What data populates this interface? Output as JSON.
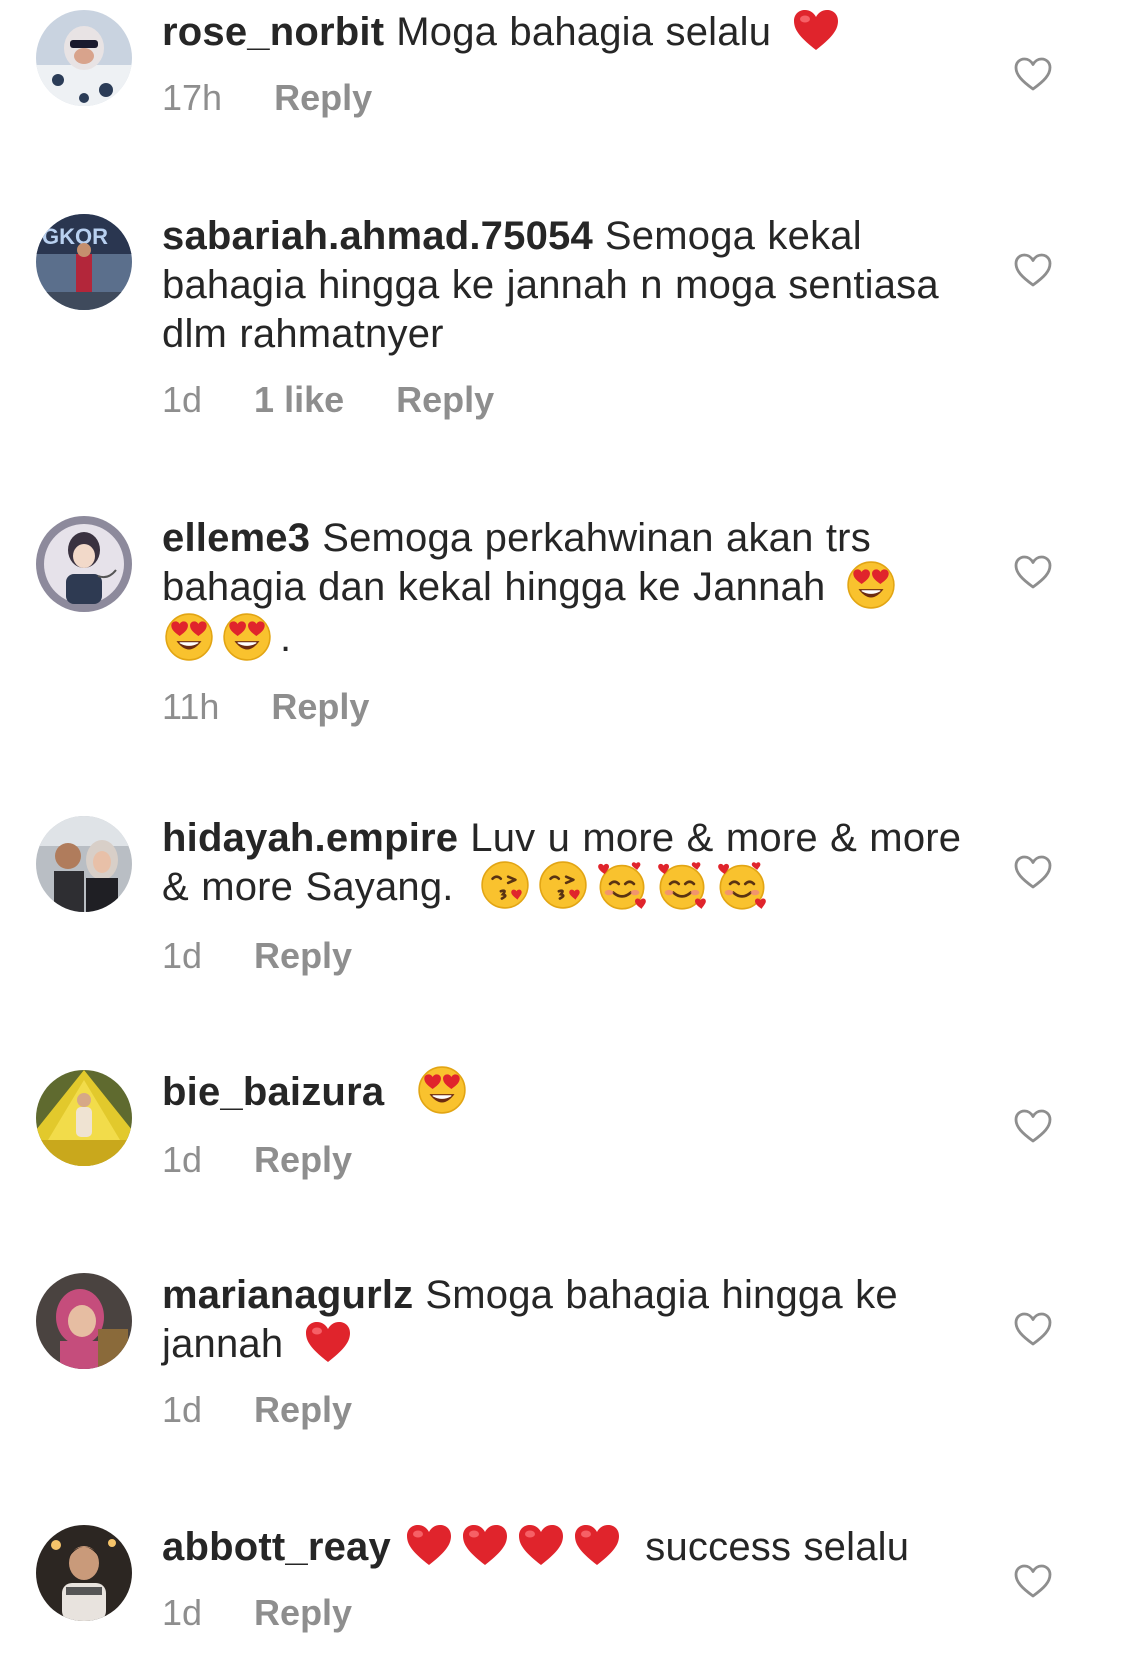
{
  "comments": [
    {
      "username": "rose_norbit",
      "text": "Moga bahagia selalu",
      "time": "17h",
      "likes": "",
      "reply": "Reply"
    },
    {
      "username": "sabariah.ahmad.75054",
      "text": "Semoga kekal bahagia hingga ke jannah n moga sentiasa dlm rahmatnyer",
      "time": "1d",
      "likes": "1 like",
      "reply": "Reply"
    },
    {
      "username": "elleme3",
      "text": "Semoga perkahwinan akan trs bahagia dan kekal hingga ke Jannah",
      "text_suffix": ".",
      "time": "11h",
      "likes": "",
      "reply": "Reply"
    },
    {
      "username": "hidayah.empire",
      "text": "Luv u more & more & more & more Sayang.",
      "time": "1d",
      "likes": "",
      "reply": "Reply"
    },
    {
      "username": "bie_baizura",
      "text": "",
      "time": "1d",
      "likes": "",
      "reply": "Reply"
    },
    {
      "username": "marianagurlz",
      "text": "Smoga bahagia hingga ke jannah",
      "time": "1d",
      "likes": "",
      "reply": "Reply"
    },
    {
      "username": "abbott_reay",
      "text": "success selalu",
      "time": "1d",
      "likes": "",
      "reply": "Reply"
    }
  ],
  "colors": {
    "text": "#262626",
    "secondary": "#8e8e8e",
    "heart_red": "#e0242c",
    "emoji_yellow": "#f9c22e"
  },
  "icons": {
    "like": "heart-outline-icon",
    "red_heart": "red-heart-emoji",
    "heart_eyes": "heart-eyes-emoji",
    "kiss": "face-blowing-kiss-emoji",
    "smiling_hearts": "smiling-face-with-hearts-emoji"
  }
}
